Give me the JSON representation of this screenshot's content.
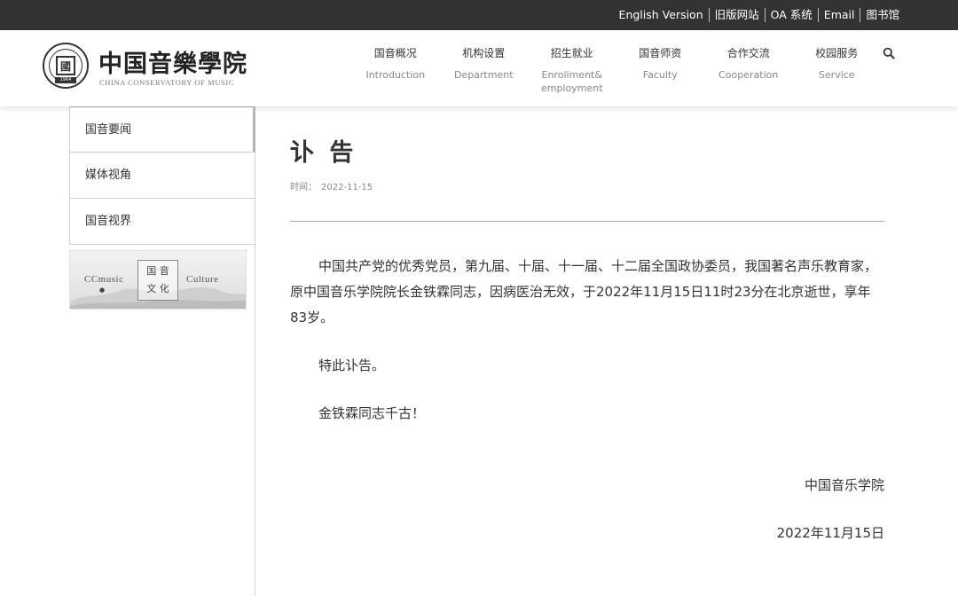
{
  "topbar": {
    "links": [
      "English Version",
      "旧版网站",
      "OA 系统",
      "Email",
      "图书馆"
    ]
  },
  "header": {
    "logo_cn": "中国音樂學院",
    "logo_en": "CHINA CONSERVATORY OF MUSIC",
    "emblem_text": "國",
    "emblem_year": "1964",
    "nav": [
      {
        "cn": "国音概况",
        "en": "Introduction"
      },
      {
        "cn": "机构设置",
        "en": "Department"
      },
      {
        "cn": "招生就业",
        "en": "Enrollment& employment"
      },
      {
        "cn": "国音师资",
        "en": "Faculty"
      },
      {
        "cn": "合作交流",
        "en": "Cooperation"
      },
      {
        "cn": "校园服务",
        "en": "Service"
      }
    ],
    "search_icon": "search-icon"
  },
  "sidebar": {
    "items": [
      "国音要闻",
      "媒体视角",
      "国音视界"
    ],
    "banner": {
      "left_text": "CCmusic",
      "right_text": "Culture",
      "box_line1": "国 音",
      "box_line2": "文 化"
    }
  },
  "article": {
    "title": "讣 告",
    "meta_label": "时间：",
    "meta_date": "2022-11-15",
    "paragraphs": [
      "中国共产党的优秀党员，第九届、十届、十一届、十二届全国政协委员，我国著名声乐教育家，原中国音乐学院院长金铁霖同志，因病医治无效，于2022年11月15日11时23分在北京逝世，享年83岁。",
      "特此讣告。",
      "金铁霖同志千古！"
    ],
    "signature": "中国音乐学院",
    "sign_date": "2022年11月15日"
  },
  "colors": {
    "topbar_bg": "#333333",
    "text": "#333333",
    "muted": "#888888",
    "border": "#d0d0d0"
  }
}
